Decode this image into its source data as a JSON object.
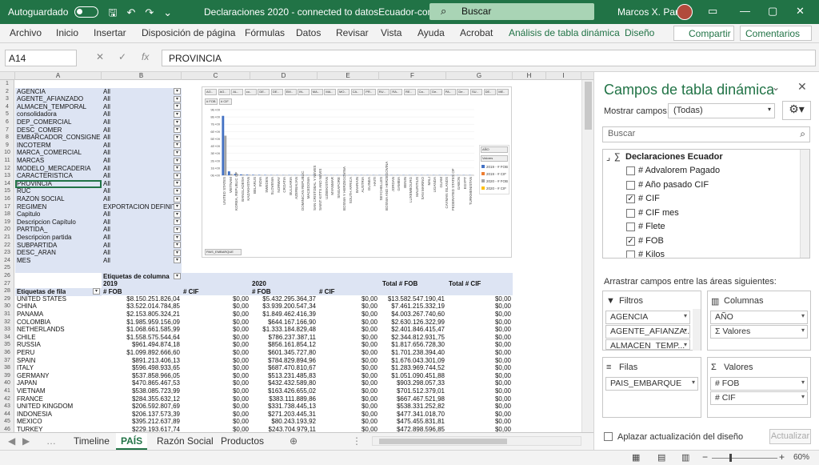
{
  "titlebar": {
    "autosave_label": "Autoguardado",
    "doc_title": "Declaraciones 2020 - connected to datosEcuador-com.xlsx",
    "search_placeholder": "Buscar",
    "user_name": "Marcos X. Parra"
  },
  "ribbon": {
    "tabs": [
      "Archivo",
      "Inicio",
      "Insertar",
      "Disposición de página",
      "Fórmulas",
      "Datos",
      "Revisar",
      "Vista",
      "Ayuda",
      "Acrobat",
      "Análisis de tabla dinámica",
      "Diseño"
    ],
    "share": "Compartir",
    "comments": "Comentarios"
  },
  "formula_bar": {
    "name_box": "A14",
    "content": "PROVINCIA"
  },
  "columns": [
    "A",
    "B",
    "C",
    "D",
    "E",
    "F",
    "G",
    "H",
    "I"
  ],
  "rows": [
    "1",
    "2",
    "3",
    "4",
    "5",
    "6",
    "7",
    "8",
    "9",
    "10",
    "11",
    "12",
    "13",
    "14",
    "15",
    "16",
    "17",
    "18",
    "19",
    "20",
    "21",
    "22",
    "23",
    "24",
    "25",
    "26",
    "27",
    "28",
    "29",
    "30",
    "31",
    "32",
    "33",
    "34",
    "35",
    "36",
    "37",
    "38",
    "39",
    "40",
    "41",
    "42",
    "43",
    "44",
    "45",
    "46"
  ],
  "filters": [
    {
      "field": "AGENCIA",
      "value": "All"
    },
    {
      "field": "AGENTE_AFIANZADO",
      "value": "All"
    },
    {
      "field": "ALMACEN_TEMPORAL",
      "value": "All"
    },
    {
      "field": "consolidadora",
      "value": "All"
    },
    {
      "field": "DEP_COMERCIAL",
      "value": "All"
    },
    {
      "field": "DESC_COMER",
      "value": "All"
    },
    {
      "field": "EMBARCADOR_CONSIGNEE",
      "value": "All"
    },
    {
      "field": "INCOTERM",
      "value": "All"
    },
    {
      "field": "MARCA_COMERCIAL",
      "value": "All"
    },
    {
      "field": "MARCAS",
      "value": "All"
    },
    {
      "field": "MODELO_MERCADERIA",
      "value": "All"
    },
    {
      "field": "CARACTERISTICA",
      "value": "All"
    },
    {
      "field": "PROVINCIA",
      "value": "All"
    },
    {
      "field": "RUC",
      "value": "All"
    },
    {
      "field": "RAZON SOCIAL",
      "value": "All"
    },
    {
      "field": "REGIMEN",
      "value": "EXPORTACION DEFINITIVA"
    },
    {
      "field": "Capitulo",
      "value": "All"
    },
    {
      "field": "Descripcion Capítulo",
      "value": "All"
    },
    {
      "field": "PARTIDA_",
      "value": "All"
    },
    {
      "field": "Descripcion partida",
      "value": "All"
    },
    {
      "field": "SUBPARTIDA",
      "value": "All"
    },
    {
      "field": "DESC_ARAN",
      "value": "All"
    },
    {
      "field": "MES",
      "value": "All"
    }
  ],
  "pivot": {
    "col_labels": "Etiquetas de columna",
    "row_labels": "Etiquetas de fila",
    "year1": "2019",
    "year2": "2020",
    "fob": "# FOB",
    "cif": "# CIF",
    "total_fob": "Total # FOB",
    "total_cif": "Total # CIF",
    "rows": [
      {
        "country": "UNITED STATES",
        "fob19": "$8.150.251.826,04",
        "cif19": "$0,00",
        "fob20": "$5.432.295.364,37",
        "cif20": "$0,00",
        "tfob": "$13.582.547.190,41",
        "tcif": "$0,00"
      },
      {
        "country": "CHINA",
        "fob19": "$3.522.014.784,85",
        "cif19": "$0,00",
        "fob20": "$3.939.200.547,34",
        "cif20": "$0,00",
        "tfob": "$7.461.215.332,19",
        "tcif": "$0,00"
      },
      {
        "country": "PANAMA",
        "fob19": "$2.153.805.324,21",
        "cif19": "$0,00",
        "fob20": "$1.849.462.416,39",
        "cif20": "$0,00",
        "tfob": "$4.003.267.740,60",
        "tcif": "$0,00"
      },
      {
        "country": "COLOMBIA",
        "fob19": "$1.985.959.156,09",
        "cif19": "$0,00",
        "fob20": "$644.167.166,90",
        "cif20": "$0,00",
        "tfob": "$2.630.126.322,99",
        "tcif": "$0,00"
      },
      {
        "country": "NETHERLANDS",
        "fob19": "$1.068.661.585,99",
        "cif19": "$0,00",
        "fob20": "$1.333.184.829,48",
        "cif20": "$0,00",
        "tfob": "$2.401.846.415,47",
        "tcif": "$0,00"
      },
      {
        "country": "CHILE",
        "fob19": "$1.558.575.544,64",
        "cif19": "$0,00",
        "fob20": "$786.237.387,11",
        "cif20": "$0,00",
        "tfob": "$2.344.812.931,75",
        "tcif": "$0,00"
      },
      {
        "country": "RUSSIA",
        "fob19": "$961.494.874,18",
        "cif19": "$0,00",
        "fob20": "$856.161.854,12",
        "cif20": "$0,00",
        "tfob": "$1.817.656.728,30",
        "tcif": "$0,00"
      },
      {
        "country": "PERU",
        "fob19": "$1.099.892.666,60",
        "cif19": "$0,00",
        "fob20": "$601.345.727,80",
        "cif20": "$0,00",
        "tfob": "$1.701.238.394,40",
        "tcif": "$0,00"
      },
      {
        "country": "SPAIN",
        "fob19": "$891.213.406,13",
        "cif19": "$0,00",
        "fob20": "$784.829.894,96",
        "cif20": "$0,00",
        "tfob": "$1.676.043.301,09",
        "tcif": "$0,00"
      },
      {
        "country": "ITALY",
        "fob19": "$596.498.933,65",
        "cif19": "$0,00",
        "fob20": "$687.470.810,67",
        "cif20": "$0,00",
        "tfob": "$1.283.969.744,52",
        "tcif": "$0,00"
      },
      {
        "country": "GERMANY",
        "fob19": "$537.858.966,05",
        "cif19": "$0,00",
        "fob20": "$513.231.485,83",
        "cif20": "$0,00",
        "tfob": "$1.051.090.451,88",
        "tcif": "$0,00"
      },
      {
        "country": "JAPAN",
        "fob19": "$470.865.467,53",
        "cif19": "$0,00",
        "fob20": "$432.432.589,80",
        "cif20": "$0,00",
        "tfob": "$903.298.057,33",
        "tcif": "$0,00"
      },
      {
        "country": "VIETNAM",
        "fob19": "$538.085.723,99",
        "cif19": "$0,00",
        "fob20": "$163.426.655,02",
        "cif20": "$0,00",
        "tfob": "$701.512.379,01",
        "tcif": "$0,00"
      },
      {
        "country": "FRANCE",
        "fob19": "$284.355.632,12",
        "cif19": "$0,00",
        "fob20": "$383.111.889,86",
        "cif20": "$0,00",
        "tfob": "$667.467.521,98",
        "tcif": "$0,00"
      },
      {
        "country": "UNITED KINGDOM",
        "fob19": "$206.592.807,69",
        "cif19": "$0,00",
        "fob20": "$331.738.445,13",
        "cif20": "$0,00",
        "tfob": "$538.331.252,82",
        "tcif": "$0,00"
      },
      {
        "country": "INDONESIA",
        "fob19": "$206.137.573,39",
        "cif19": "$0,00",
        "fob20": "$271.203.445,31",
        "cif20": "$0,00",
        "tfob": "$477.341.018,70",
        "tcif": "$0,00"
      },
      {
        "country": "MEXICO",
        "fob19": "$395.212.637,89",
        "cif19": "$0,00",
        "fob20": "$80.243.193,92",
        "cif20": "$0,00",
        "tfob": "$475.455.831,81",
        "tcif": "$0,00"
      },
      {
        "country": "TURKEY",
        "fob19": "$229.193.617,74",
        "cif19": "$0,00",
        "fob20": "$243.704.979,11",
        "cif20": "$0,00",
        "tfob": "$472.898.596,85",
        "tcif": "$0,00"
      }
    ]
  },
  "chart": {
    "field_buttons": [
      "AG..",
      "AG..",
      "AL..",
      "co..",
      "DE..",
      "DE..",
      "EM..",
      "IN..",
      "MA..",
      "MA..",
      "MO..",
      "CA..",
      "PR..",
      "RU..",
      "RA..",
      "RE..",
      "Ca..",
      "De..",
      "PA..",
      "De..",
      "SU..",
      "DE..",
      "ME.."
    ],
    "value_buttons": [
      "# FOB",
      "# CIF"
    ],
    "legend_title": "AÑO",
    "legend_sub": "Valores",
    "legend_items": [
      {
        "label": "2019 - # FOB",
        "color": "#4472c4"
      },
      {
        "label": "2019 - # CIF",
        "color": "#ed7d31"
      },
      {
        "label": "2020 - # FOB",
        "color": "#a5a5a5"
      },
      {
        "label": "2020 - # CIF",
        "color": "#ffc000"
      }
    ],
    "axis_button": "PAIS_EMBARQUE",
    "y_ticks": [
      "9E+09",
      "8E+09",
      "7E+09",
      "6E+09",
      "5E+09",
      "4E+09",
      "3E+09",
      "2E+09",
      "1E+09",
      "0E+00"
    ],
    "x_labels": [
      "UNITED STATES",
      "VIETNAM",
      "KOREA, REPUBLIC OF",
      "BANGLADESH",
      "KAZAKHSTAN",
      "BELARUS",
      "INDIA",
      "SWEDEN",
      "SLOVENIA",
      "NORWAY",
      "CROATIA",
      "BULGARIA",
      "AZERBAIJAN",
      "DOMINICAN REPUBLIC",
      "MACEDONIA",
      "SAN CRISTOBAL Y NEVES",
      "SAINT KITTS AND NEVIS",
      "UZBEKISTAN",
      "MYANMAR",
      "SINGAPORE",
      "BOSNIA Y HERZEGOVINA",
      "SOUTH AFRICA",
      "BAHRAIN",
      "AUSTRIA",
      "GUINEA",
      "HAITI",
      "SEYCHELLES",
      "BOSNIA AND HERZEGOVINA",
      "JORDAN",
      "GAMBIA",
      "BENIN",
      "LUXEMBOURG",
      "MAURITIUS",
      "SAN MARINO",
      "MALI",
      "UGANDA",
      "GUAM",
      "CAYMAN ISLANDS",
      "FEDERATED STATES OF",
      "GABON",
      "EGYPT",
      "TURKMENISTAN"
    ]
  },
  "chart_data": {
    "type": "bar",
    "title": "",
    "y_range": [
      0,
      9000000000
    ],
    "series": [
      {
        "name": "2019 - # FOB",
        "values": [
          8150251826,
          538085724,
          180000000,
          120000000,
          90000000,
          70000000,
          60000000,
          50000000,
          40000000,
          35000000,
          30000000,
          26000000,
          22000000,
          19000000,
          16000000,
          14000000,
          12000000,
          10000000,
          9000000,
          8000000,
          7000000,
          6000000,
          5000000,
          4500000,
          4000000,
          3500000,
          3000000,
          2600000,
          2200000,
          1900000,
          1600000,
          1300000,
          1100000,
          900000,
          700000,
          500000,
          400000,
          300000,
          200000,
          150000,
          100000,
          50000
        ]
      },
      {
        "name": "2020 - # FOB",
        "values": [
          5432295364,
          163426655,
          150000000,
          100000000,
          80000000,
          60000000,
          50000000,
          45000000,
          38000000,
          30000000,
          26000000,
          22000000,
          19000000,
          16000000,
          14000000,
          12000000,
          10000000,
          9000000,
          8000000,
          7000000,
          6000000,
          5000000,
          4500000,
          4000000,
          3500000,
          3000000,
          2600000,
          2200000,
          1900000,
          1600000,
          1300000,
          1100000,
          900000,
          700000,
          500000,
          400000,
          300000,
          200000,
          150000,
          100000,
          60000,
          30000
        ]
      }
    ]
  },
  "sheet_tabs": [
    "Timeline",
    "PAÍS",
    "Razón Social",
    "Productos"
  ],
  "active_sheet": "PAÍS",
  "status": {
    "zoom": "60%"
  },
  "pane": {
    "title": "Campos de tabla dinámica",
    "show_fields_label": "Mostrar campos:",
    "show_fields_value": "(Todas)",
    "search_placeholder": "Buscar",
    "table_name": "Declaraciones Ecuador",
    "fields": [
      {
        "name": "# Advalorem Pagado",
        "checked": ""
      },
      {
        "name": "# Año pasado CIF",
        "checked": ""
      },
      {
        "name": "# CIF",
        "checked": "✓"
      },
      {
        "name": "# CIF mes",
        "checked": ""
      },
      {
        "name": "# Flete",
        "checked": ""
      },
      {
        "name": "# FOB",
        "checked": "✓"
      },
      {
        "name": "# Kilos",
        "checked": ""
      }
    ],
    "drag_label": "Arrastrar campos entre las áreas siguientes:",
    "filters_title": "Filtros",
    "columns_title": "Columnas",
    "rows_title": "Filas",
    "values_title": "Valores",
    "filters_items": [
      "AGENCIA",
      "AGENTE_AFIANZA...",
      "ALMACEN_TEMP..."
    ],
    "columns_items": [
      "AÑO",
      "Σ Valores"
    ],
    "rows_items": [
      "PAIS_EMBARQUE"
    ],
    "values_items": [
      "# FOB",
      "# CIF"
    ],
    "defer_label": "Aplazar actualización del diseño",
    "update_button": "Actualizar"
  }
}
